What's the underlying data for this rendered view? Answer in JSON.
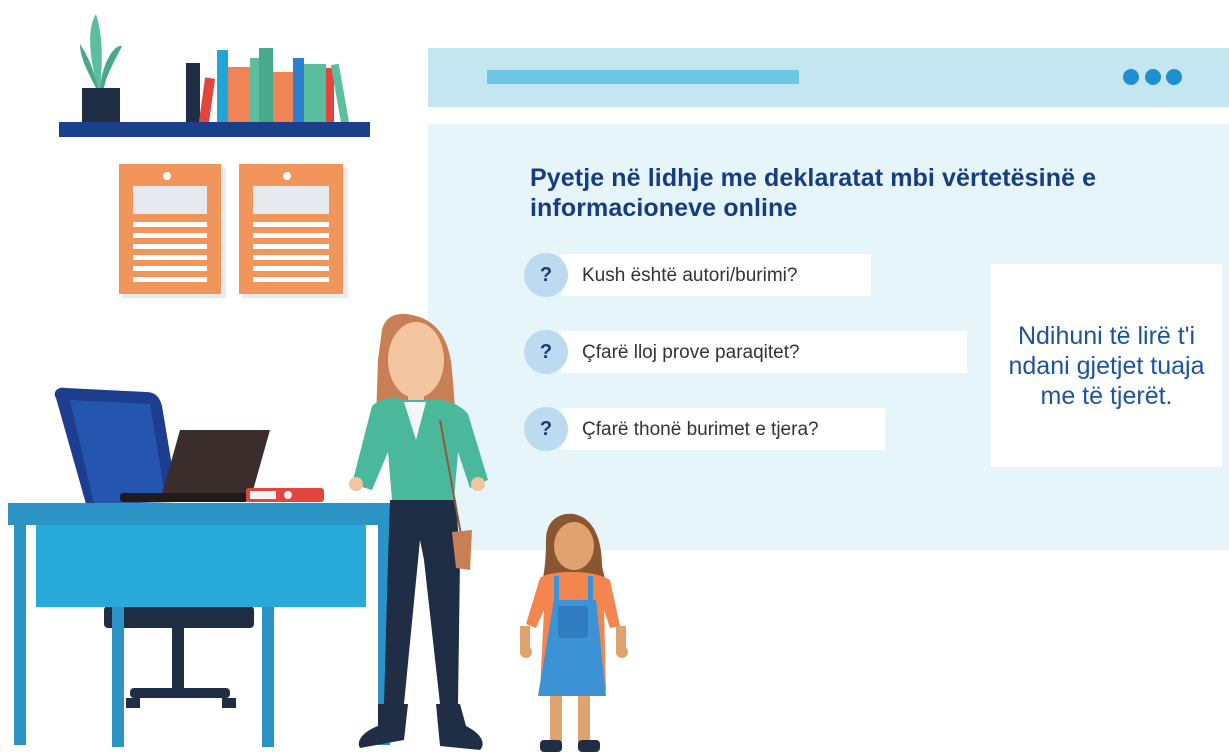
{
  "browser_window": {
    "title": "Pyetje në lidhje me deklaratat mbi vërtetësinë e informacioneve online",
    "questions": [
      {
        "icon_text": "?",
        "text": "Kush është autori/burimi?"
      },
      {
        "icon_text": "?",
        "text": "Çfarë lloj prove paraqitet?"
      },
      {
        "icon_text": "?",
        "text": "Çfarë thonë burimet e tjera?"
      }
    ],
    "side_note": "Ndihuni të lirë t'i ndani gjetjet tuaja me të tjerët."
  },
  "colors": {
    "title": "#173c86",
    "accent_blue": "#1e8fcf",
    "browser_bar": "#c3e6f1",
    "browser_body": "#e6f5fa",
    "orange": "#f2955b",
    "teal": "#5bbf9f"
  }
}
